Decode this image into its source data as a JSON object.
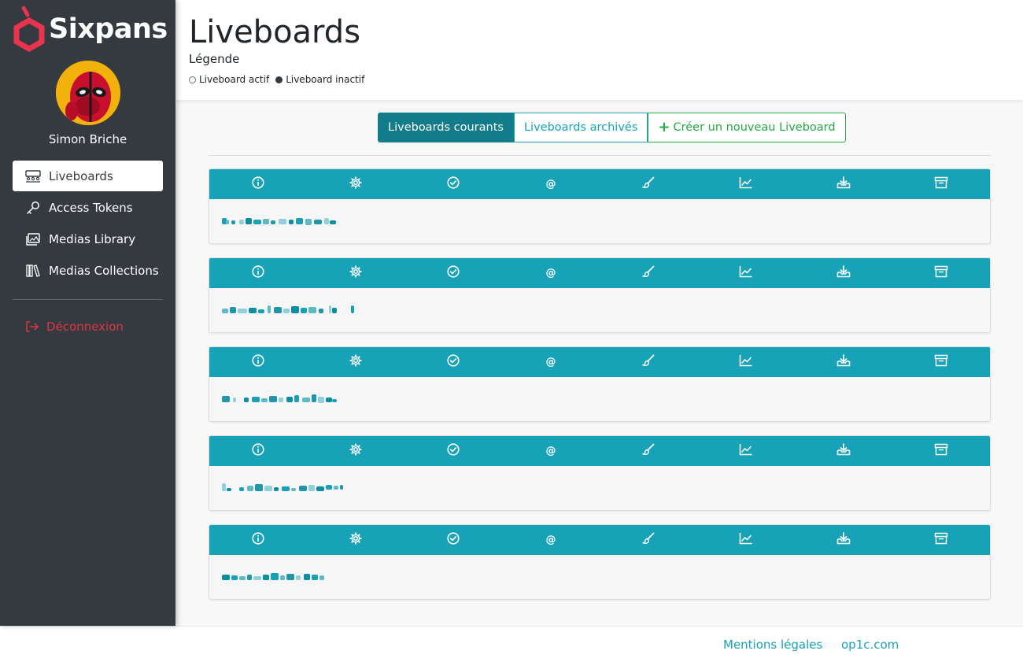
{
  "sidebar": {
    "logo_text": "Sixpans",
    "user_name": "Simon Briche",
    "nav": [
      {
        "label": "Liveboards",
        "icon": "users-group-icon",
        "active": true
      },
      {
        "label": "Access Tokens",
        "icon": "key-icon",
        "active": false
      },
      {
        "label": "Medias Library",
        "icon": "images-icon",
        "active": false
      },
      {
        "label": "Medias Collections",
        "icon": "books-icon",
        "active": false
      }
    ],
    "logout_label": "Déconnexion"
  },
  "header": {
    "title": "Liveboards",
    "legend_title": "Légende",
    "legend_active": "Liveboard actif",
    "legend_inactive": "Liveboard inactif"
  },
  "tabs": {
    "current": "Liveboards courants",
    "archived": "Liveboards archivés",
    "create": "Créer un nouveau Liveboard"
  },
  "card_actions": [
    "info-icon",
    "settings-gear-icon",
    "check-circle-icon",
    "at-sign-icon",
    "brush-icon",
    "chart-line-icon",
    "download-icon",
    "archive-icon"
  ],
  "card_count": 5,
  "footer": {
    "legal": "Mentions légales",
    "site": "op1c.com"
  },
  "colors": {
    "sidebar_bg": "#343a40",
    "accent": "#17a2b8",
    "active_tab": "#137c8b",
    "create": "#28a745",
    "logout": "#dc3545",
    "brand_red": "#e8344e"
  }
}
